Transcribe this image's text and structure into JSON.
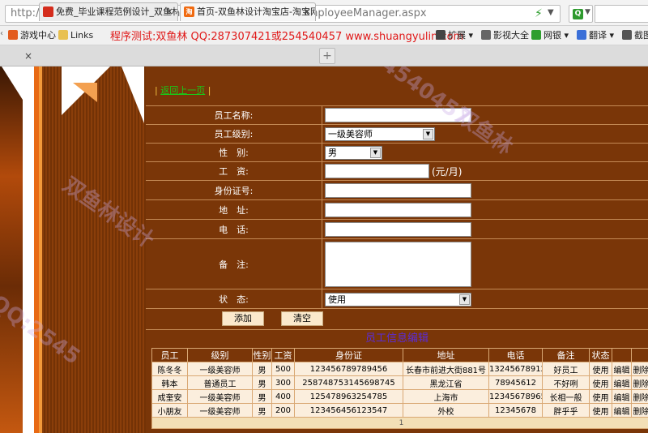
{
  "browser": {
    "url_prefix": "http://",
    "url_host": "localhost",
    "url_rest": ":44410/BeautyParlorManager/WebForm/EmployeeManager.aspx",
    "bookmarks": [
      {
        "label": "游戏中心",
        "icon": "game-icon",
        "color": "#e35b1e"
      },
      {
        "label": "Links",
        "icon": "folder-icon",
        "color": "#e8c050"
      }
    ],
    "bookmark_notice": "程序测试:双鱼林 QQ:287307421或254540457 www.shuangyulin.com",
    "right_bookmarks": [
      {
        "label": "扩展",
        "icon": "grid-icon",
        "color": "#444444"
      },
      {
        "label": "影视大全",
        "icon": "film-icon",
        "color": "#666666"
      },
      {
        "label": "网银",
        "icon": "shield-icon",
        "color": "#2e9e2e"
      },
      {
        "label": "翻译",
        "icon": "translate-icon",
        "color": "#3a6fd8"
      },
      {
        "label": "截图",
        "icon": "screenshot-icon",
        "color": "#555555"
      }
    ],
    "tabs": [
      {
        "title": "免费_毕业课程范例设计_双鱼林",
        "favicon_color": "#d42c1c"
      },
      {
        "title": "首页-双鱼林设计淘宝店-淘宝网",
        "favicon_color": "#f06a10",
        "favicon_text": "淘"
      }
    ]
  },
  "page": {
    "back_link": "返回上一页",
    "form": {
      "name_label": "员工名称:",
      "level_label": "员工级别:",
      "level_value": "一级美容师",
      "gender_label": "性　别:",
      "gender_value": "男",
      "salary_label": "工　资:",
      "salary_unit": "(元/月)",
      "idcard_label": "身份证号:",
      "address_label": "地　址:",
      "phone_label": "电　话:",
      "note_label": "备　注:",
      "status_label": "状　态:",
      "status_value": "使用"
    },
    "buttons": {
      "add": "添加",
      "clear": "清空"
    },
    "section_title": "员工信息编辑",
    "table": {
      "headers": [
        "员工",
        "级别",
        "性别",
        "工资",
        "身份证",
        "地址",
        "电话",
        "备注",
        "状态",
        "",
        ""
      ],
      "rows": [
        [
          "陈冬冬",
          "一级美容师",
          "男",
          "500",
          "123456789789456",
          "长春市前进大街881号",
          "13245678912",
          "好员工",
          "使用",
          "编辑",
          "删除"
        ],
        [
          "韩本",
          "普通员工",
          "男",
          "300",
          "258748753145698745",
          "黑龙江省",
          "78945612",
          "不好咧",
          "使用",
          "编辑",
          "删除"
        ],
        [
          "成奎安",
          "一级美容师",
          "男",
          "400",
          "125478963254785",
          "上海市",
          "123456789654",
          "长相一般",
          "使用",
          "编辑",
          "删除"
        ],
        [
          "小朋友",
          "一级美容师",
          "男",
          "200",
          "123456456123547",
          "外校",
          "12345678",
          "胖乎乎",
          "使用",
          "编辑",
          "删除"
        ]
      ],
      "pager": "1"
    },
    "watermark": [
      "双鱼林设计",
      "QQ:254540457",
      "双鱼林",
      "QQ:2545"
    ]
  }
}
